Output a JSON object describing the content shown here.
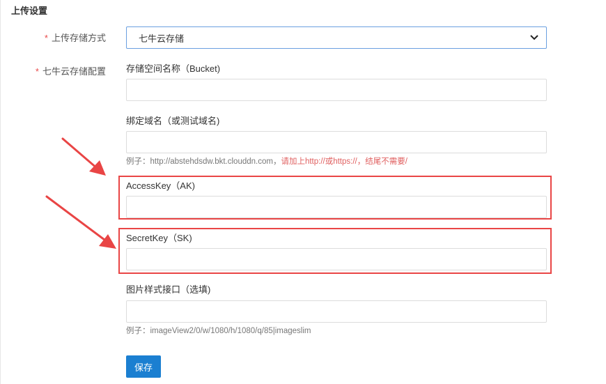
{
  "section_title": "上传设置",
  "upload_method": {
    "label": "上传存储方式",
    "required_mark": "*",
    "selected": "七牛云存储"
  },
  "qiniu_config": {
    "label": "七牛云存储配置",
    "required_mark": "*",
    "fields": {
      "bucket": {
        "label": "存储空间名称（Bucket)",
        "value": ""
      },
      "domain": {
        "label": "绑定域名（或测试域名)",
        "value": "",
        "hint_prefix": "例子：http://abstehdsdw.bkt.clouddn.com，",
        "hint_warning": "请加上http://或https://，结尾不需要/"
      },
      "access_key": {
        "label": "AccessKey（AK)",
        "value": ""
      },
      "secret_key": {
        "label": "SecretKey（SK)",
        "value": ""
      },
      "image_style": {
        "label": "图片样式接口（选填)",
        "value": "",
        "hint": "例子：imageView2/0/w/1080/h/1080/q/85|imageslim"
      }
    }
  },
  "save_button": "保存",
  "colors": {
    "annotation_red": "#e94545",
    "primary_button": "#1b7fd1",
    "warning_text": "#e06060"
  },
  "icons": {
    "dropdown": "chevron-down-icon",
    "annotation": "arrow-icon"
  }
}
